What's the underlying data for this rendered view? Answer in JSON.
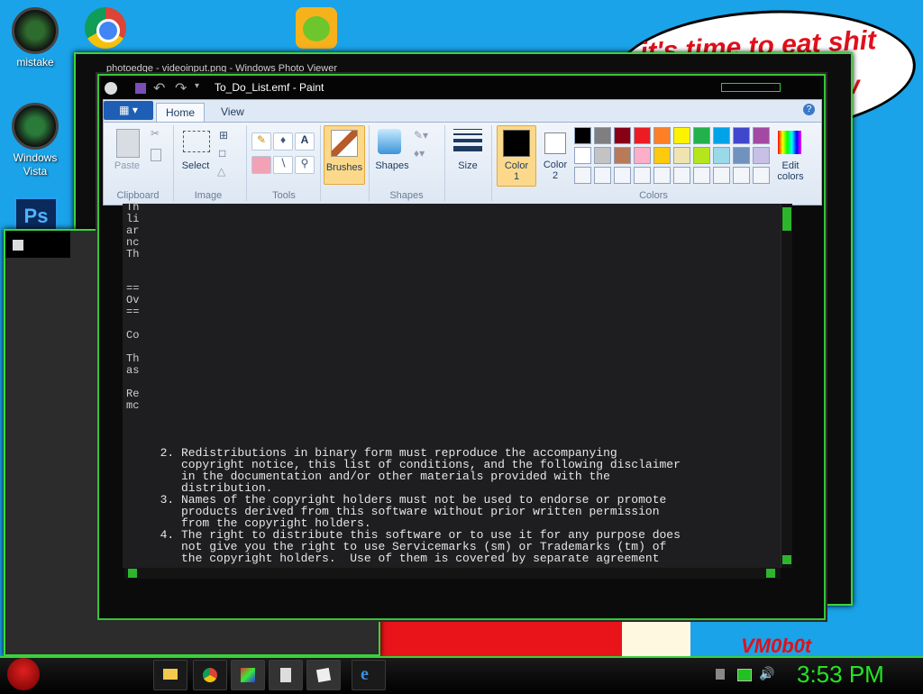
{
  "desktop": {
    "icons": [
      {
        "label": "mistake"
      },
      {
        "label": "Windows Vista"
      }
    ],
    "ps_label": "Ps",
    "bubble_text": "it's time to eat shit",
    "bubble_text2": "w",
    "watermark": "VM0b0t"
  },
  "photo_viewer": {
    "title": "photoedge - videoinput.png - Windows Photo Viewer"
  },
  "paint": {
    "title": "To_Do_List.emf - Paint",
    "tabs": {
      "file": "",
      "home": "Home",
      "view": "View"
    },
    "groups": {
      "clipboard": "Clipboard",
      "image": "Image",
      "tools": "Tools",
      "shapes": "Shapes",
      "colors": "Colors"
    },
    "buttons": {
      "paste": "Paste",
      "select": "Select",
      "brushes": "Brushes",
      "shapes": "Shapes",
      "size": "Size",
      "color1": "Color 1",
      "color2": "Color 2",
      "edit_colors": "Edit colors"
    },
    "palette_row1": [
      "#000000",
      "#7f7f7f",
      "#880015",
      "#ed1c24",
      "#ff7f27",
      "#fff200",
      "#22b14c",
      "#00a2e8",
      "#3f48cc",
      "#a349a4"
    ],
    "palette_row2": [
      "#ffffff",
      "#c3c3c3",
      "#b97a57",
      "#ffaec9",
      "#ffc90e",
      "#efe4b0",
      "#b5e61d",
      "#99d9ea",
      "#7092be",
      "#c8bfe7"
    ],
    "color1_value": "#000000",
    "color2_value": "#ffffff"
  },
  "document": {
    "left_fragments": [
      "Th",
      "li",
      "ar",
      "nc",
      "Th",
      "==",
      "Ov",
      "==",
      "Co",
      "Th",
      "as",
      "Re",
      "mc"
    ],
    "lines": [
      "  2. Redistributions in binary form must reproduce the accompanying",
      "     copyright notice, this list of conditions, and the following disclaimer",
      "     in the documentation and/or other materials provided with the",
      "     distribution.",
      "  3. Names of the copyright holders must not be used to endorse or promote",
      "     products derived from this software without prior written permission",
      "     from the copyright holders.",
      "  4. The right to distribute this software or to use it for any purpose does",
      "     not give you the right to use Servicemarks (sm) or Trademarks (tm) of",
      "     the copyright holders.  Use of them is covered by separate agreement"
    ]
  },
  "taskbar": {
    "clock": "3:53 PM"
  }
}
